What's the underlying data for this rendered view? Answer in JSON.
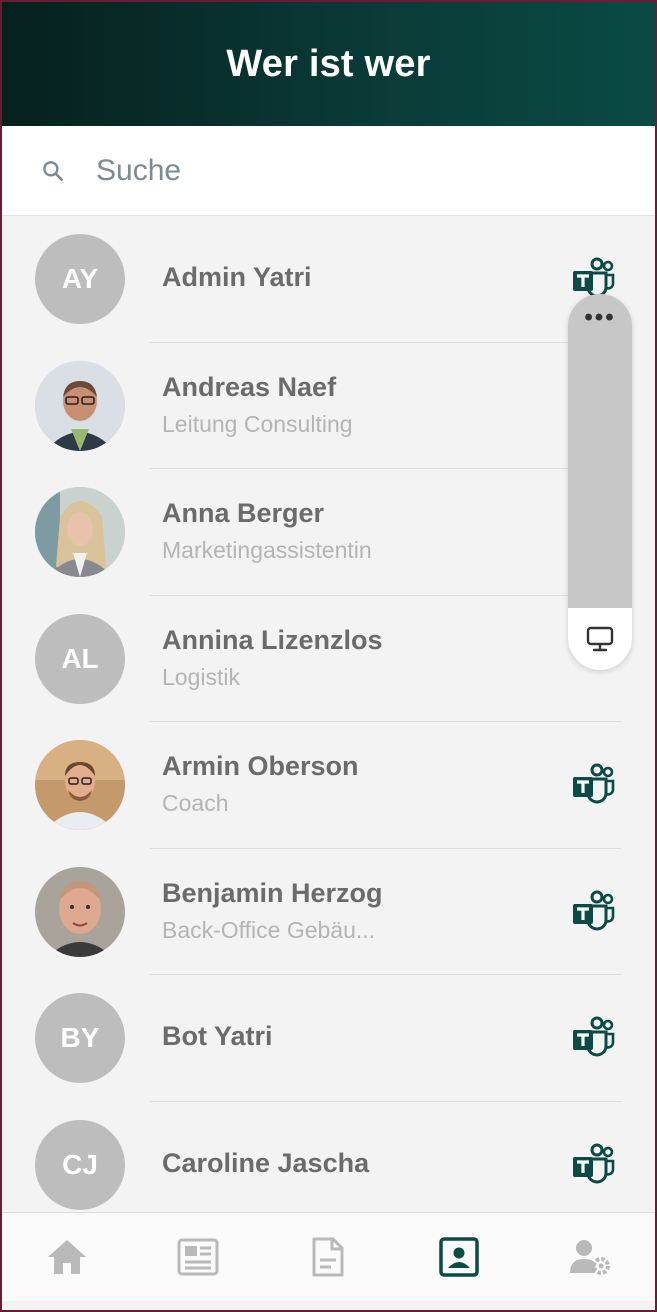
{
  "header": {
    "title": "Wer ist wer"
  },
  "search": {
    "placeholder": "Suche",
    "value": ""
  },
  "contacts": [
    {
      "initials": "AY",
      "name": "Admin Yatri",
      "role": "",
      "teams": true
    },
    {
      "initials": "",
      "name": "Andreas Naef",
      "role": "Leitung Consulting",
      "teams": false
    },
    {
      "initials": "",
      "name": "Anna Berger",
      "role": "Marketingassistentin",
      "teams": false
    },
    {
      "initials": "AL",
      "name": "Annina Lizenzlos",
      "role": "Logistik",
      "teams": false
    },
    {
      "initials": "",
      "name": "Armin Oberson",
      "role": "Coach",
      "teams": true
    },
    {
      "initials": "",
      "name": "Benjamin Herzog",
      "role": "Back-Office Gebäu...",
      "teams": true
    },
    {
      "initials": "BY",
      "name": "Bot Yatri",
      "role": "",
      "teams": true
    },
    {
      "initials": "CJ",
      "name": "Caroline Jascha",
      "role": "",
      "teams": true
    }
  ],
  "floating_panel": {
    "more_icon": "more-dots-icon",
    "screen_icon": "monitor-icon"
  },
  "nav": {
    "items": [
      "home-icon",
      "news-icon",
      "document-icon",
      "contacts-icon",
      "user-settings-icon"
    ],
    "active": "contacts-icon",
    "accent": "#0b4a45",
    "inactive_color": "#b9b9b9"
  },
  "colors": {
    "header_start": "#06201e",
    "header_end": "#0a4a45",
    "avatar_bg": "#bdbdbd",
    "teams": "#0b4a45"
  }
}
